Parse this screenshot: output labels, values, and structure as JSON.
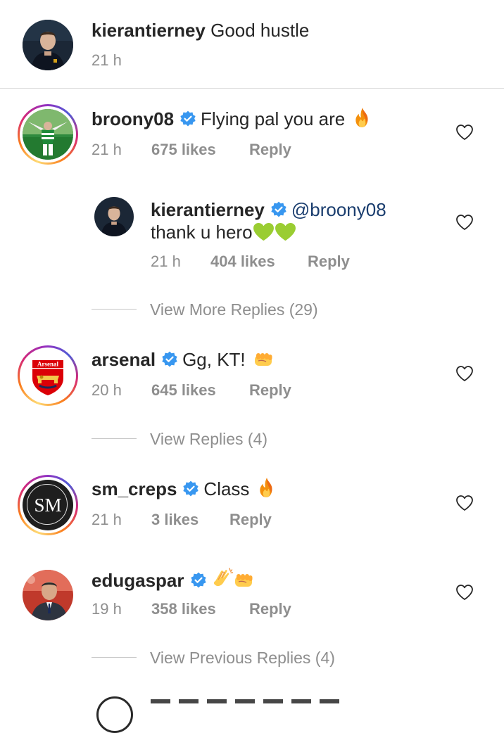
{
  "caption": {
    "username": "kierantierney",
    "text": "Good hustle",
    "time": "21 h"
  },
  "comments": [
    {
      "username": "broony08",
      "text": "Flying pal you are",
      "emoji": "fire-icon",
      "time": "21 h",
      "likes": "675 likes",
      "reply": "Reply",
      "reply_thread": {
        "username": "kierantierney",
        "mention": "@broony08",
        "text": "thank u hero",
        "emoji": "green-heart-icon",
        "time": "21 h",
        "likes": "404 likes",
        "reply": "Reply"
      },
      "view_more": "View More Replies (29)"
    },
    {
      "username": "arsenal",
      "text": "Gg, KT!",
      "emoji": "fist-icon",
      "time": "20 h",
      "likes": "645 likes",
      "reply": "Reply",
      "view_more": "View Replies (4)"
    },
    {
      "username": "sm_creps",
      "text": "Class",
      "emoji": "fire-icon",
      "time": "21 h",
      "likes": "3 likes",
      "reply": "Reply",
      "avatar_text": "SM"
    },
    {
      "username": "edugaspar",
      "text": "",
      "emoji": "clap-fist-icon",
      "time": "19 h",
      "likes": "358 likes",
      "reply": "Reply",
      "view_more": "View Previous Replies (4)"
    }
  ],
  "colors": {
    "verified": "#3897f0",
    "meta_gray": "#8e8e8e",
    "text": "#262626",
    "mention": "#1a3d6e",
    "arsenal_red": "#db0007"
  }
}
